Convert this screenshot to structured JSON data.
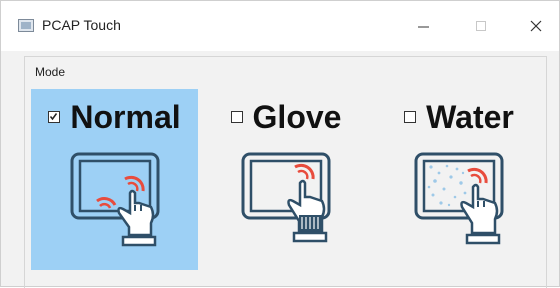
{
  "window": {
    "title": "PCAP Touch",
    "icon": "app-icon"
  },
  "controls": {
    "minimize": "minimize-icon",
    "maximize": "maximize-icon",
    "close": "close-icon"
  },
  "group": {
    "label": "Mode"
  },
  "modes": [
    {
      "label": "Normal",
      "checked": true,
      "icon": "normal-touch-icon"
    },
    {
      "label": "Glove",
      "checked": false,
      "icon": "glove-touch-icon"
    },
    {
      "label": "Water",
      "checked": false,
      "icon": "water-touch-icon"
    }
  ],
  "colors": {
    "selected": "#9dd0f5",
    "touch_ring": "#e84c3d",
    "outline": "#2f4f68"
  }
}
